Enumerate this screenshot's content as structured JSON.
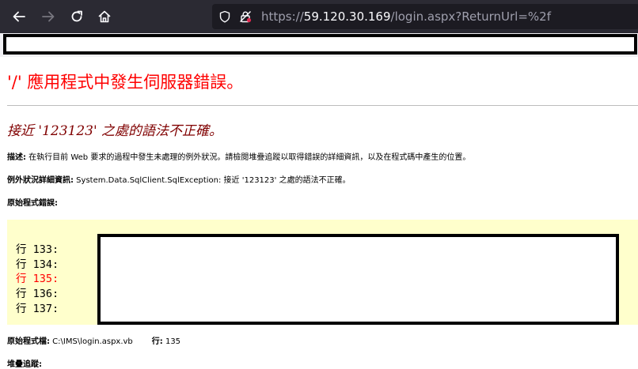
{
  "browser": {
    "url_scheme": "https://",
    "url_host": "59.120.30.169",
    "url_path": "/login.aspx?ReturnUrl=%2f"
  },
  "page": {
    "title": "'/' 應用程式中發生伺服器錯誤。",
    "error_heading": "接近 '123123' 之處的語法不正確。",
    "description_label": "描述:",
    "description_text": " 在執行目前 Web 要求的過程中發生未處理的例外狀況。請檢閱堆疊追蹤以取得錯誤的詳細資訊，以及在程式碼中產生的位置。",
    "exception_label": "例外狀況詳細資訊:",
    "exception_text": " System.Data.SqlClient.SqlException: 接近 '123123' 之處的語法不正確。",
    "source_error_label": "原始程式錯誤:",
    "code_lines": [
      "行 133:",
      "行 134:",
      "行 135:",
      "行 136:",
      "行 137:"
    ],
    "source_file_label": "原始程式檔:",
    "source_file": " C:\\IMS\\login.aspx.vb",
    "line_label": "行:",
    "line_number": " 135",
    "stack_trace_label": "堆疊追蹤:"
  }
}
